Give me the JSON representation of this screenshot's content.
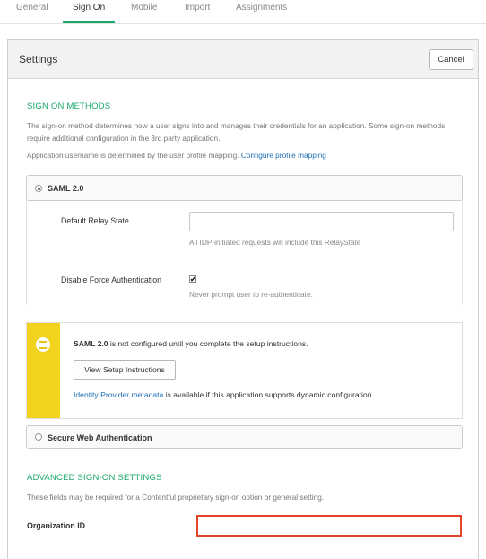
{
  "tabs": [
    {
      "label": "General"
    },
    {
      "label": "Sign On"
    },
    {
      "label": "Mobile"
    },
    {
      "label": "Import"
    },
    {
      "label": "Assignments"
    }
  ],
  "active_tab": "Sign On",
  "settings": {
    "title": "Settings",
    "cancel_label": "Cancel"
  },
  "sign_on_methods": {
    "title": "SIGN ON METHODS",
    "description": "The sign-on method determines how a user signs into and manages their credentials for an application. Some sign-on methods require additional configuration in the 3rd party application.",
    "username_text": "Application username is determined by the user profile mapping.",
    "username_link": "Configure profile mapping",
    "saml": {
      "label": "SAML 2.0",
      "selected": true,
      "relay_state_label": "Default Relay State",
      "relay_state_value": "",
      "relay_state_help": "All IDP-initiated requests will include this RelayState",
      "force_auth_label": "Disable Force Authentication",
      "force_auth_checked": true,
      "force_auth_check_glyph": "✔",
      "force_auth_help": "Never prompt user to re-authenticate."
    },
    "notice": {
      "icon": "list-icon",
      "bold": "SAML 2.0",
      "text": " is not configured until you complete the setup instructions.",
      "button_label": "View Setup Instructions",
      "link": "Identity Provider metadata",
      "link_suffix": " is available if this application supports dynamic configuration."
    },
    "swa": {
      "label": "Secure Web Authentication",
      "selected": false
    }
  },
  "advanced": {
    "title": "ADVANCED SIGN-ON SETTINGS",
    "description": "These fields may be required for a Contentful proprietary sign-on option or general setting.",
    "org_id_label": "Organization ID",
    "org_id_value": ""
  },
  "colors": {
    "accent": "#1aa86b",
    "link": "#1f6fb5",
    "notice_bar": "#f1d21c",
    "highlight_border": "#e2432b"
  }
}
